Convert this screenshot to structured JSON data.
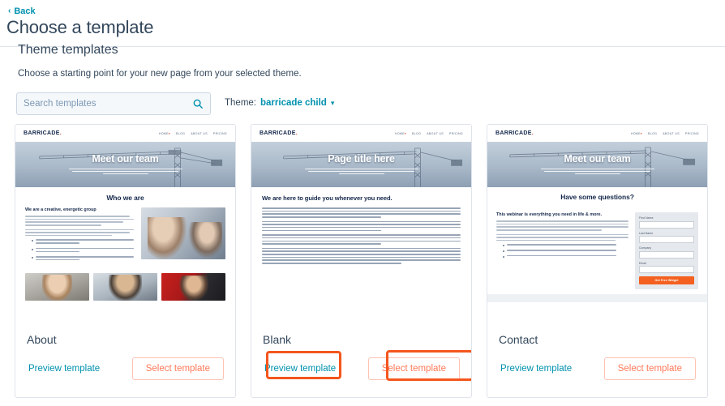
{
  "header": {
    "back_label": "Back",
    "back_icon": "chevron-left-icon",
    "title": "Choose a template"
  },
  "section": {
    "title": "Theme templates",
    "description": "Choose a starting point for your new page from your selected theme."
  },
  "search": {
    "placeholder": "Search templates",
    "value": "",
    "icon": "search-icon"
  },
  "theme_filter": {
    "label": "Theme:",
    "value": "barricade child",
    "caret_icon": "chevron-down-icon"
  },
  "mini_site": {
    "logo": "BARRICADE",
    "logo_dot": ".",
    "nav": [
      "HOME",
      "BLOG",
      "ABOUT US",
      "PRICING"
    ],
    "nav_caret": "▾"
  },
  "cards": [
    {
      "name": "About",
      "hero_title": "Meet our team",
      "section_heading": "Who we are",
      "sub_heading": "We are a creative, energetic group",
      "preview_label": "Preview template",
      "select_label": "Select template",
      "highlighted": false
    },
    {
      "name": "Blank",
      "hero_title": "Page title here",
      "section_heading": "We are here to guide you whenever you need.",
      "sub_heading": "",
      "preview_label": "Preview template",
      "select_label": "Select template",
      "highlighted": true
    },
    {
      "name": "Contact",
      "hero_title": "Meet our team",
      "section_heading": "Have some questions?",
      "sub_heading": "This webinar is everything you need in life & more.",
      "preview_label": "Preview template",
      "select_label": "Select template",
      "highlighted": false,
      "form": {
        "fields": [
          "First Name",
          "Last Name",
          "Company",
          "Email"
        ],
        "submit_label": "Get Free Widget"
      }
    }
  ],
  "colors": {
    "link": "#0091ae",
    "heading": "#33475b",
    "select_button_text": "#ff7a59",
    "select_button_border": "#ffc2b2",
    "highlight_outline": "#f4561d",
    "mini_logo": "#15284b",
    "mini_accent": "#e8431f",
    "form_button": "#f4601f",
    "card_border": "#dfe3eb"
  }
}
